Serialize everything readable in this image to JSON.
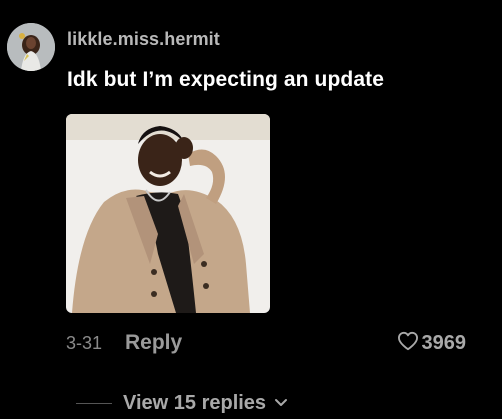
{
  "comment": {
    "username": "likkle.miss.hermit",
    "text": "Idk but I’m expecting an update",
    "date": "3-31",
    "reply_label": "Reply",
    "like_count": "3969",
    "view_replies_label": "View 15 replies"
  },
  "icons": {
    "avatar": "user-avatar",
    "like": "heart-outline-icon",
    "expand": "chevron-down-icon"
  },
  "colors": {
    "background": "#000000",
    "username": "#b9b9b9",
    "text": "#ffffff",
    "meta": "#8a8a8a",
    "secondary": "#a9a9a9"
  }
}
